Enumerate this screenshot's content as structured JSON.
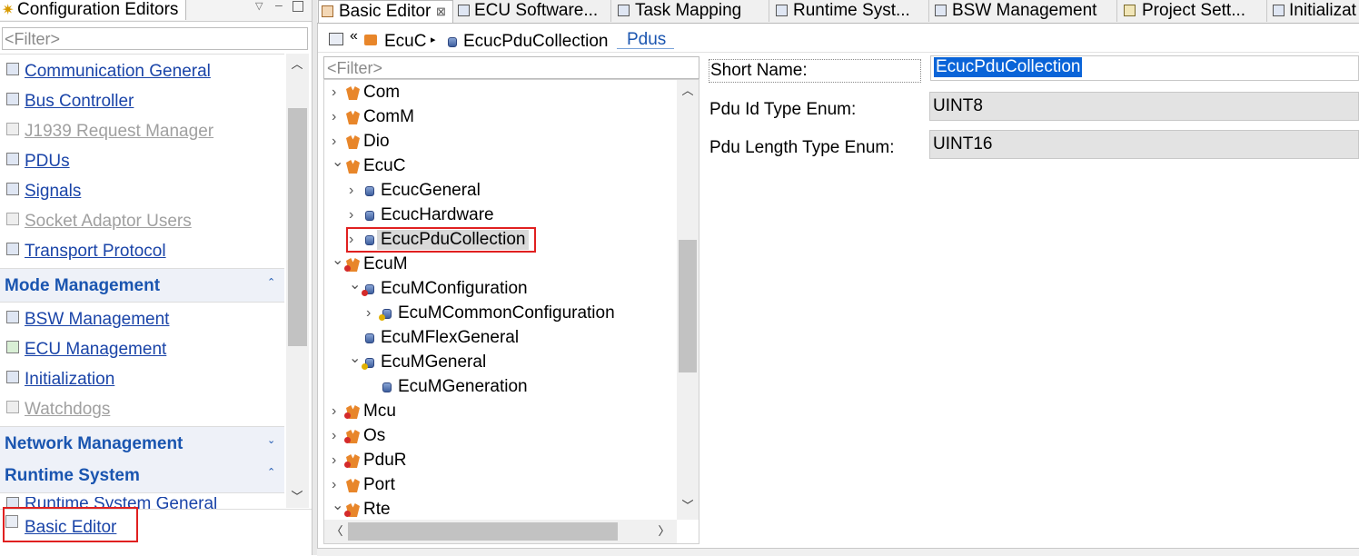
{
  "left_view": {
    "title": "Configuration Editors",
    "filter_placeholder": "<Filter>",
    "items_top": [
      {
        "label": "Communication General",
        "disabled": false
      },
      {
        "label": "Bus Controller",
        "disabled": false
      },
      {
        "label": "J1939 Request Manager",
        "disabled": true
      },
      {
        "label": "PDUs",
        "disabled": false
      },
      {
        "label": "Signals",
        "disabled": false
      },
      {
        "label": "Socket Adaptor Users",
        "disabled": true
      },
      {
        "label": "Transport Protocol",
        "disabled": false
      }
    ],
    "section_mode": "Mode Management",
    "items_mode": [
      {
        "label": "BSW Management",
        "disabled": false
      },
      {
        "label": "ECU Management",
        "disabled": false
      },
      {
        "label": "Initialization",
        "disabled": false
      },
      {
        "label": "Watchdogs",
        "disabled": true
      }
    ],
    "section_network": "Network Management",
    "section_runtime": "Runtime System",
    "item_runtime_partial": "Runtime System General",
    "basic_editor_link": "Basic Editor"
  },
  "editor_tabs": [
    {
      "label": "Basic Editor",
      "active": true
    },
    {
      "label": "ECU Software...",
      "active": false
    },
    {
      "label": "Task Mapping",
      "active": false
    },
    {
      "label": "Runtime Syst...",
      "active": false
    },
    {
      "label": "BSW Management",
      "active": false
    },
    {
      "label": "Project Sett...",
      "active": false
    },
    {
      "label": "Initializat",
      "active": false
    }
  ],
  "breadcrumb": {
    "root": "EcuC",
    "current": "EcucPduCollection",
    "link": "Pdus"
  },
  "tree": {
    "filter_placeholder": "<Filter>",
    "rows": [
      {
        "label": "Com",
        "level": 0,
        "expander": ">",
        "icon": "module-icon"
      },
      {
        "label": "ComM",
        "level": 0,
        "expander": ">",
        "icon": "module-icon"
      },
      {
        "label": "Dio",
        "level": 0,
        "expander": ">",
        "icon": "module-icon"
      },
      {
        "label": "EcuC",
        "level": 0,
        "expander": "v",
        "icon": "module-icon"
      },
      {
        "label": "EcucGeneral",
        "level": 1,
        "expander": ">",
        "icon": "container-icon"
      },
      {
        "label": "EcucHardware",
        "level": 1,
        "expander": ">",
        "icon": "container-icon"
      },
      {
        "label": "EcucPduCollection",
        "level": 1,
        "expander": ">",
        "icon": "container-icon",
        "selected": true
      },
      {
        "label": "EcuM",
        "level": 0,
        "expander": "v",
        "icon": "module-error-icon"
      },
      {
        "label": "EcuMConfiguration",
        "level": 1,
        "expander": "v",
        "icon": "container-error-icon"
      },
      {
        "label": "EcuMCommonConfiguration",
        "level": 2,
        "expander": ">",
        "icon": "container-warning-icon"
      },
      {
        "label": "EcuMFlexGeneral",
        "level": 1,
        "expander": "",
        "icon": "container-icon"
      },
      {
        "label": "EcuMGeneral",
        "level": 1,
        "expander": "v",
        "icon": "container-warning-icon"
      },
      {
        "label": "EcuMGeneration",
        "level": 2,
        "expander": "",
        "icon": "container-icon"
      },
      {
        "label": "Mcu",
        "level": 0,
        "expander": ">",
        "icon": "module-error-icon"
      },
      {
        "label": "Os",
        "level": 0,
        "expander": ">",
        "icon": "module-error-icon"
      },
      {
        "label": "PduR",
        "level": 0,
        "expander": ">",
        "icon": "module-error-icon"
      },
      {
        "label": "Port",
        "level": 0,
        "expander": ">",
        "icon": "module-icon"
      },
      {
        "label": "Rte",
        "level": 0,
        "expander": "v",
        "icon": "module-error-icon"
      }
    ]
  },
  "properties": {
    "short_name_label": "Short Name:",
    "short_name_value": "EcucPduCollection",
    "pdu_id_label": "Pdu Id Type Enum:",
    "pdu_id_value": "UINT8",
    "pdu_length_label": "Pdu Length Type Enum:",
    "pdu_length_value": "UINT16"
  },
  "colors": {
    "link": "#1a44a8",
    "section": "#1a55b0",
    "highlight_box": "#e02020",
    "selection": "#0a64d8"
  }
}
